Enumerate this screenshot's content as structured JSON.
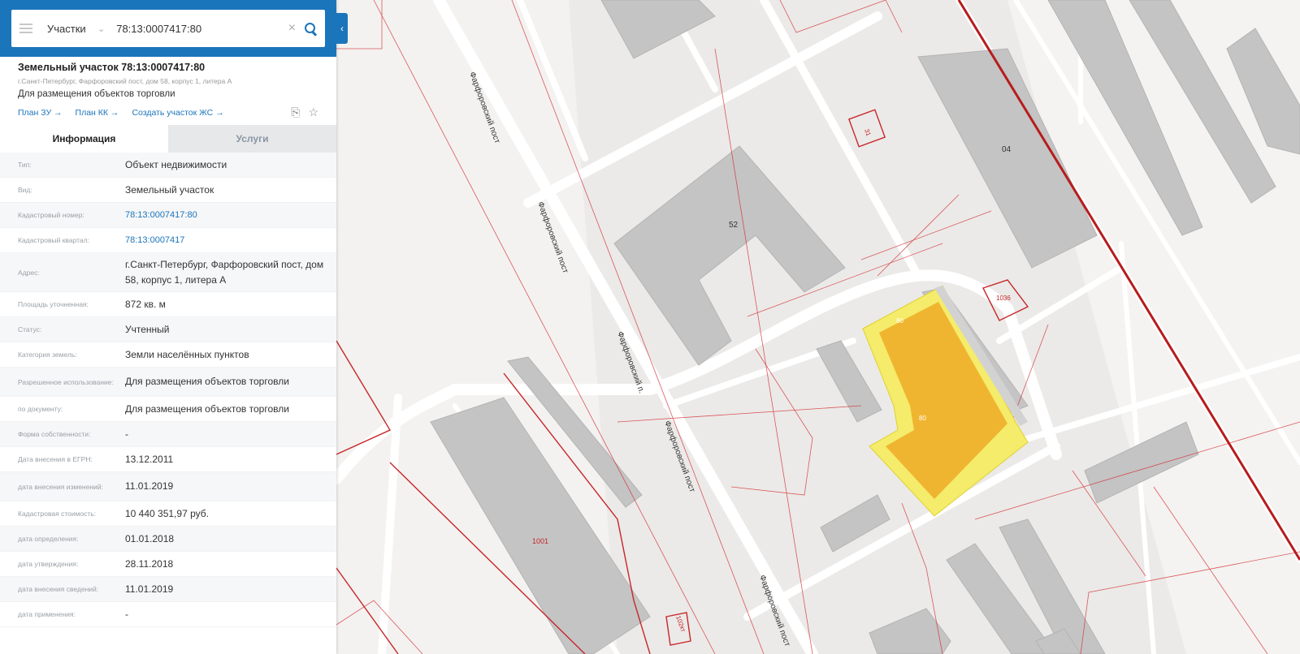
{
  "search": {
    "type_label": "Участки",
    "value": "78:13:0007417:80"
  },
  "object": {
    "title": "Земельный участок 78:13:0007417:80",
    "address_small": "г.Санкт-Петербург, Фарфоровский пост, дом 58, корпус 1, литера А",
    "purpose": "Для размещения объектов торговли",
    "links": [
      "План ЗУ →",
      "План КК →",
      "Создать участок ЖС →"
    ]
  },
  "tabs": [
    "Информация",
    "Услуги"
  ],
  "rows": [
    {
      "label": "Тип:",
      "value": "Объект недвижимости"
    },
    {
      "label": "Вид:",
      "value": "Земельный участок"
    },
    {
      "label": "Кадастровый номер:",
      "value": "78:13:0007417:80",
      "link": true
    },
    {
      "label": "Кадастровый квартал:",
      "value": "78:13:0007417",
      "link": true
    },
    {
      "label": "Адрес:",
      "value": "г.Санкт-Петербург, Фарфоровский пост, дом 58, корпус 1, литера А"
    },
    {
      "label": "Площадь уточненная:",
      "value": "872 кв. м"
    },
    {
      "label": "Статус:",
      "value": "Учтенный"
    },
    {
      "label": "Категория земель:",
      "value": "Земли населённых пунктов"
    },
    {
      "label": "Разрешенное использование:",
      "value": "Для размещения объектов торговли"
    },
    {
      "label": "по документу:",
      "value": "Для размещения объектов торговли"
    },
    {
      "label": "Форма собственности:",
      "value": "-"
    },
    {
      "label": "Дата внесения в ЕГРН:",
      "value": "13.12.2011"
    },
    {
      "label": "дата внесения изменений:",
      "value": "11.01.2019"
    },
    {
      "label": "Кадастровая стоимость:",
      "value": "10 440 351,97 руб."
    },
    {
      "label": "дата определения:",
      "value": "01.01.2018"
    },
    {
      "label": "дата утверждения:",
      "value": "28.11.2018"
    },
    {
      "label": "дата внесения сведений:",
      "value": "11.01.2019"
    },
    {
      "label": "дата применения:",
      "value": "-"
    }
  ],
  "map": {
    "street_name": "Фарфоровский пост",
    "street_name_short": "Фарфоровский п.",
    "building_labels": [
      "52",
      "04",
      "1001",
      "80",
      "1036",
      "31",
      "102кт"
    ],
    "parcel_label": "80",
    "colors": {
      "parcel_fill": "#f0b530",
      "parcel_outline": "#f4ec6a",
      "cadastral_line": "#d4242a",
      "building": "#c4c4c4",
      "road": "#ffffff"
    }
  }
}
